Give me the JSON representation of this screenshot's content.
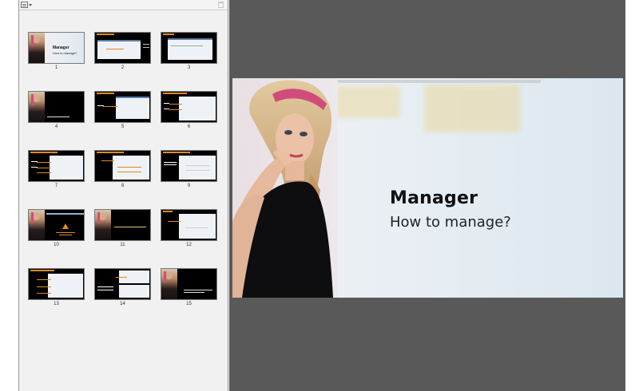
{
  "panel": {
    "view_icon": "thumbnail-view-icon",
    "delete_icon": "trash-icon"
  },
  "thumbnails": [
    {
      "num": "1",
      "title": "Manager",
      "subtitle": "How to manage?"
    },
    {
      "num": "2"
    },
    {
      "num": "3"
    },
    {
      "num": "4"
    },
    {
      "num": "5"
    },
    {
      "num": "6"
    },
    {
      "num": "7"
    },
    {
      "num": "8"
    },
    {
      "num": "9"
    },
    {
      "num": "10"
    },
    {
      "num": "11"
    },
    {
      "num": "12"
    },
    {
      "num": "13"
    },
    {
      "num": "14"
    },
    {
      "num": "15"
    }
  ],
  "main_slide": {
    "title": "Manager",
    "subtitle": "How to manage?"
  },
  "colors": {
    "stage_bg": "#595959",
    "panel_bg": "#f1f1f1",
    "accent_orange": "#e08a1e",
    "hair_pink": "#d04d7b"
  }
}
